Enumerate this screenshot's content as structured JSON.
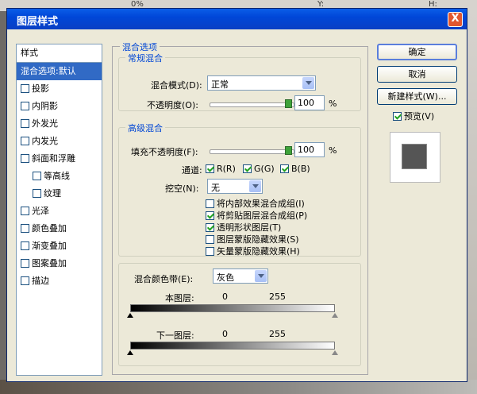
{
  "background": {
    "y_label": "Y:",
    "h_label": "H:",
    "pct": "0%"
  },
  "dialog": {
    "title": "图层样式",
    "close_label": "X"
  },
  "styles_panel": {
    "header": "样式",
    "items": [
      {
        "label": "混合选项:默认",
        "selected": true,
        "checkbox": false,
        "sub": false
      },
      {
        "label": "投影",
        "checkbox": true,
        "sub": false
      },
      {
        "label": "内阴影",
        "checkbox": true,
        "sub": false
      },
      {
        "label": "外发光",
        "checkbox": true,
        "sub": false
      },
      {
        "label": "内发光",
        "checkbox": true,
        "sub": false
      },
      {
        "label": "斜面和浮雕",
        "checkbox": true,
        "sub": false
      },
      {
        "label": "等高线",
        "checkbox": true,
        "sub": true
      },
      {
        "label": "纹理",
        "checkbox": true,
        "sub": true
      },
      {
        "label": "光泽",
        "checkbox": true,
        "sub": false
      },
      {
        "label": "颜色叠加",
        "checkbox": true,
        "sub": false
      },
      {
        "label": "渐变叠加",
        "checkbox": true,
        "sub": false
      },
      {
        "label": "图案叠加",
        "checkbox": true,
        "sub": false
      },
      {
        "label": "描边",
        "checkbox": true,
        "sub": false
      }
    ]
  },
  "blending": {
    "group_title": "混合选项",
    "general": {
      "title": "常规混合",
      "mode_label": "混合模式(D):",
      "mode_value": "正常",
      "opacity_label": "不透明度(O):",
      "opacity_value": "100",
      "unit": "%"
    },
    "advanced": {
      "title": "高级混合",
      "fill_label": "填充不透明度(F):",
      "fill_value": "100",
      "unit": "%",
      "channels_label": "通道:",
      "channels": [
        "R(R)",
        "G(G)",
        "B(B)"
      ],
      "knockout_label": "挖空(N):",
      "knockout_value": "无",
      "options": [
        {
          "label": "将内部效果混合成组(I)",
          "checked": false
        },
        {
          "label": "将剪贴图层混合成组(P)",
          "checked": true
        },
        {
          "label": "透明形状图层(T)",
          "checked": true
        },
        {
          "label": "图层蒙版隐藏效果(S)",
          "checked": false
        },
        {
          "label": "矢量蒙版隐藏效果(H)",
          "checked": false
        }
      ]
    },
    "blend_if": {
      "label": "混合颜色带(E):",
      "value": "灰色",
      "this_layer": "本图层:",
      "underlying": "下一图层:",
      "min": "0",
      "max": "255"
    }
  },
  "buttons": {
    "ok": "确定",
    "cancel": "取消",
    "new_style": "新建样式(W)...",
    "preview_label": "预览(V)"
  },
  "colors": {
    "accent": "#316ac5",
    "title_blue": "#0047d8",
    "group_blue": "#0046d5"
  }
}
